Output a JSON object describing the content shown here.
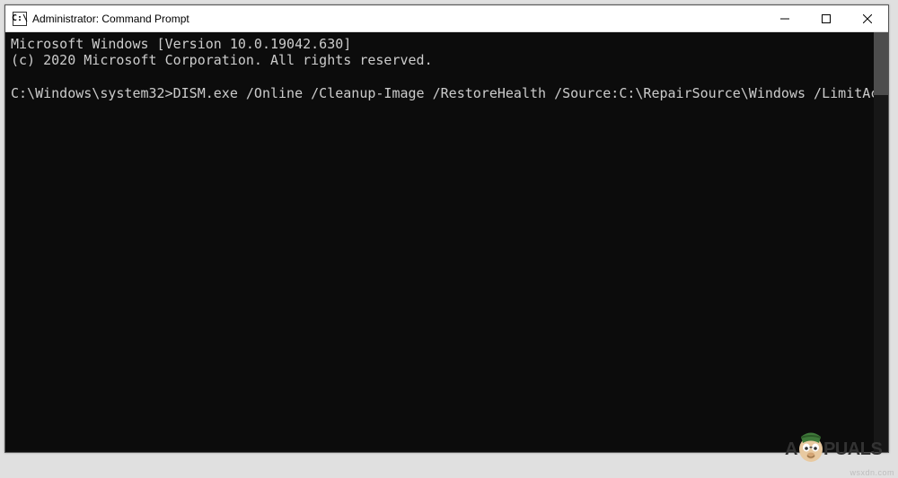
{
  "window": {
    "icon_label": "C:\\",
    "title": "Administrator: Command Prompt"
  },
  "terminal": {
    "version_line": "Microsoft Windows [Version 10.0.19042.630]",
    "copyright_line": "(c) 2020 Microsoft Corporation. All rights reserved.",
    "prompt": "C:\\Windows\\system32>",
    "command": "DISM.exe /Online /Cleanup-Image /RestoreHealth /Source:C:\\RepairSource\\Windows /LimitAccess"
  },
  "watermark": {
    "text_before": "A",
    "text_after": "PUALS",
    "site": "wsxdn.com"
  }
}
